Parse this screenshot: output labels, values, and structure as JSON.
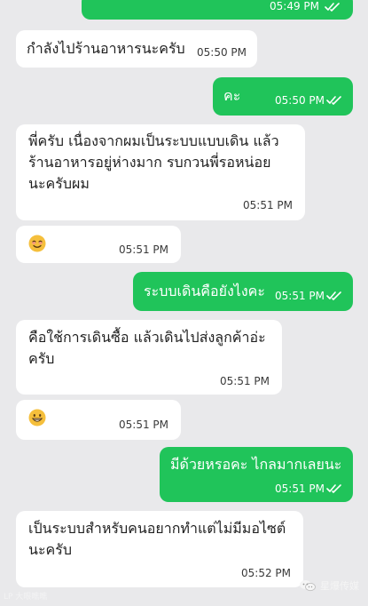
{
  "messages": [
    {
      "side": "out",
      "text": "",
      "time": "05:49 PM"
    },
    {
      "side": "in",
      "text": "กำลังไปร้านอาหารนะครับ",
      "time": "05:50 PM"
    },
    {
      "side": "out",
      "text": "คะ",
      "time": "05:50 PM"
    },
    {
      "side": "in",
      "text": "พี่ครับ เนื่องจากผมเป็นระบบแบบเดิน แล้ว\nร้านอาหารอยู่ห่างมาก รบกวนพี่รอหน่อย\nนะครับผม",
      "time": "05:51 PM"
    },
    {
      "side": "in",
      "text": "",
      "emoji": "smiling-face-icon",
      "time": "05:51 PM"
    },
    {
      "side": "out",
      "text": "ระบบเดินคือยังไงคะ",
      "time": "05:51 PM"
    },
    {
      "side": "in",
      "text": "คือใช้การเดินซื้อ แล้วเดินไปส่งลูกค้าอ่ะ\nครับ",
      "time": "05:51 PM"
    },
    {
      "side": "in",
      "text": "",
      "emoji": "grinning-face-icon",
      "time": "05:51 PM"
    },
    {
      "side": "out",
      "text": "มีด้วยหรอคะ ไกลมากเลยนะ",
      "time": "05:51 PM"
    },
    {
      "side": "in",
      "text": "เป็นระบบสำหรับคนอยากทำแต่ไม่มีมอไซต์\nนะครับ",
      "time": "05:52 PM"
    }
  ],
  "watermark": {
    "left": "LP 大眼瞧瞧",
    "right": "星爆传媒",
    "icon": "wechat-icon"
  },
  "colors": {
    "background": "#e9e9eb",
    "incoming_bubble": "#ffffff",
    "outgoing_bubble": "#20c45a",
    "text": "#1f1f1f"
  }
}
